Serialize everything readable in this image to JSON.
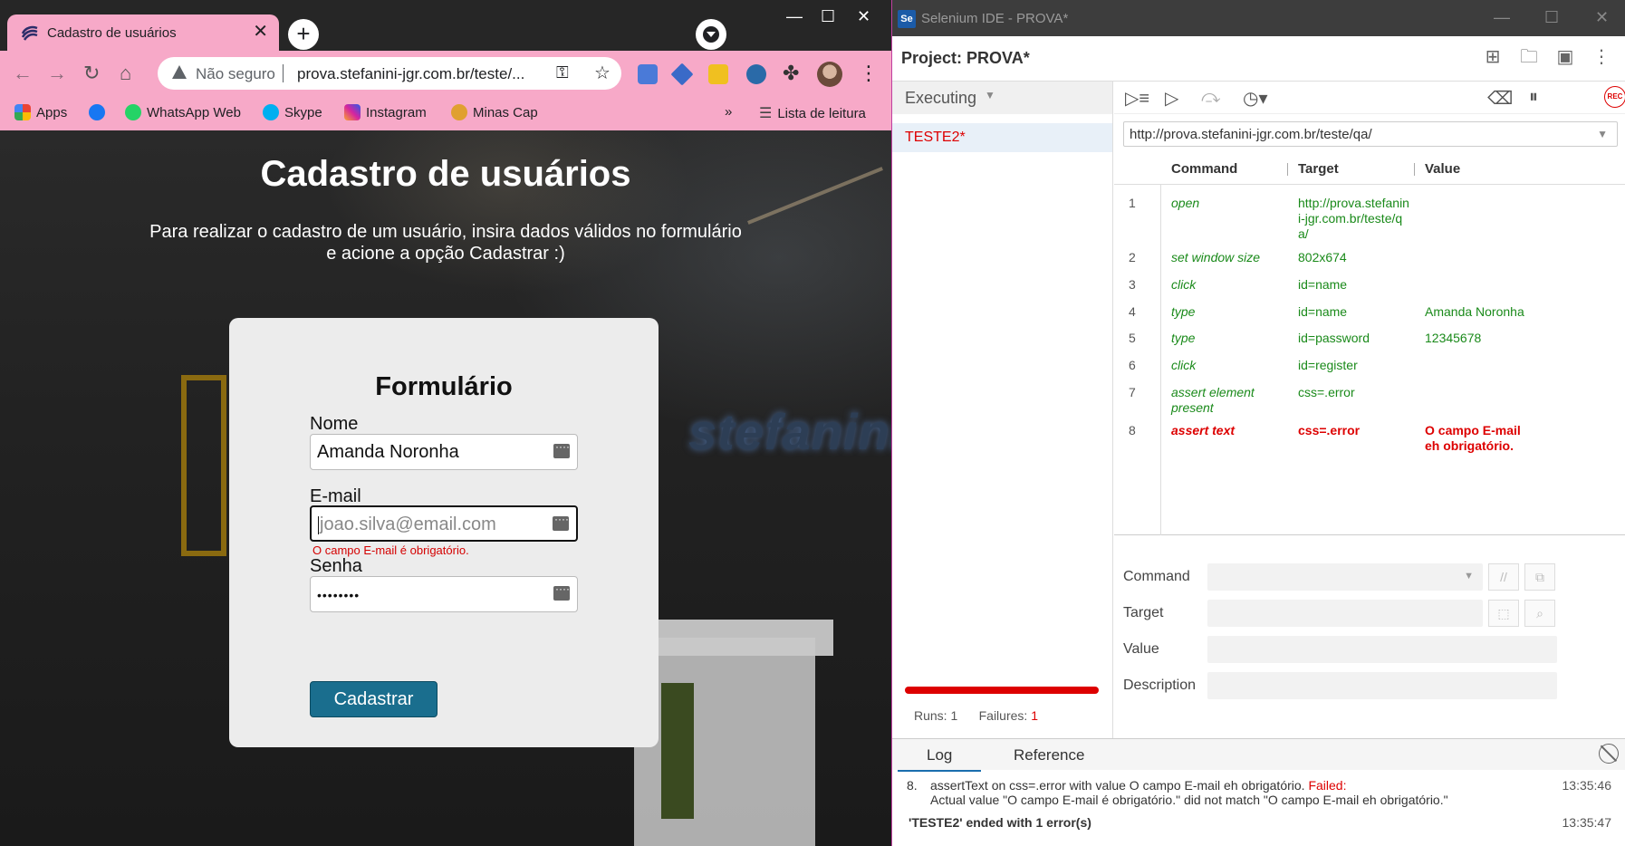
{
  "chrome": {
    "tab_title": "Cadastro de usuários",
    "tab_close": "✕",
    "new_tab": "+",
    "window_controls": [
      "—",
      "☐",
      "✕"
    ],
    "security_label": "Não seguro",
    "url": "prova.stefanini-jgr.com.br/teste/...",
    "bookmarks": [
      "Apps",
      "WhatsApp Web",
      "Skype",
      "Instagram",
      "Minas Cap"
    ],
    "bookmarks_more": "»",
    "reading_list": "Lista de leitura"
  },
  "page": {
    "heading": "Cadastro de usuários",
    "subtitle_line1": "Para realizar o cadastro de um usuário, insira dados válidos no formulário",
    "subtitle_line2": "e acione a opção Cadastrar :)",
    "form": {
      "title": "Formulário",
      "name_label": "Nome",
      "name_value": "Amanda Noronha",
      "email_label": "E-mail",
      "email_placeholder": "joao.silva@email.com",
      "email_error": "O campo E-mail é obrigatório.",
      "password_label": "Senha",
      "password_value": "••••••••",
      "submit_label": "Cadastrar"
    },
    "wall_logo": "stefanini"
  },
  "ide": {
    "window_title": "Selenium IDE - PROVA*",
    "app_badge": "Se",
    "project_label": "Project:",
    "project_name": "PROVA*",
    "executing_label": "Executing",
    "test_name": "TESTE2*",
    "base_url": "http://prova.stefanini-jgr.com.br/teste/qa/",
    "columns": {
      "command": "Command",
      "target": "Target",
      "value": "Value"
    },
    "commands": [
      {
        "n": "1",
        "command": "open",
        "target": "http://prova.stefanini-jgr.com.br/teste/qa/",
        "value": ""
      },
      {
        "n": "2",
        "command": "set window size",
        "target": "802x674",
        "value": ""
      },
      {
        "n": "3",
        "command": "click",
        "target": "id=name",
        "value": ""
      },
      {
        "n": "4",
        "command": "type",
        "target": "id=name",
        "value": "Amanda Noronha"
      },
      {
        "n": "5",
        "command": "type",
        "target": "id=password",
        "value": "12345678"
      },
      {
        "n": "6",
        "command": "click",
        "target": "id=register",
        "value": ""
      },
      {
        "n": "7",
        "command": "assert element present",
        "target": "css=.error",
        "value": ""
      },
      {
        "n": "8",
        "command": "assert text",
        "target": "css=.error",
        "value": "O campo E-mail eh obrigatório."
      }
    ],
    "failed_row": 8,
    "editor": {
      "command_label": "Command",
      "target_label": "Target",
      "value_label": "Value",
      "description_label": "Description",
      "comment_btn": "//"
    },
    "runs_label": "Runs:",
    "runs_value": "1",
    "failures_label": "Failures:",
    "failures_value": "1",
    "progress_color": "#d00000",
    "rec_label": "REC",
    "log": {
      "tab_log": "Log",
      "tab_reference": "Reference",
      "entry_num": "8.",
      "entry_text": "assertText on css=.error with value O campo E-mail eh obrigatório.",
      "entry_failed": "Failed:",
      "entry_detail": "Actual value \"O campo E-mail é obrigatório.\" did not match \"O campo E-mail eh obrigatório.\"",
      "entry_time": "13:35:46",
      "summary": "'TESTE2' ended with 1 error(s)",
      "summary_time": "13:35:47"
    }
  }
}
